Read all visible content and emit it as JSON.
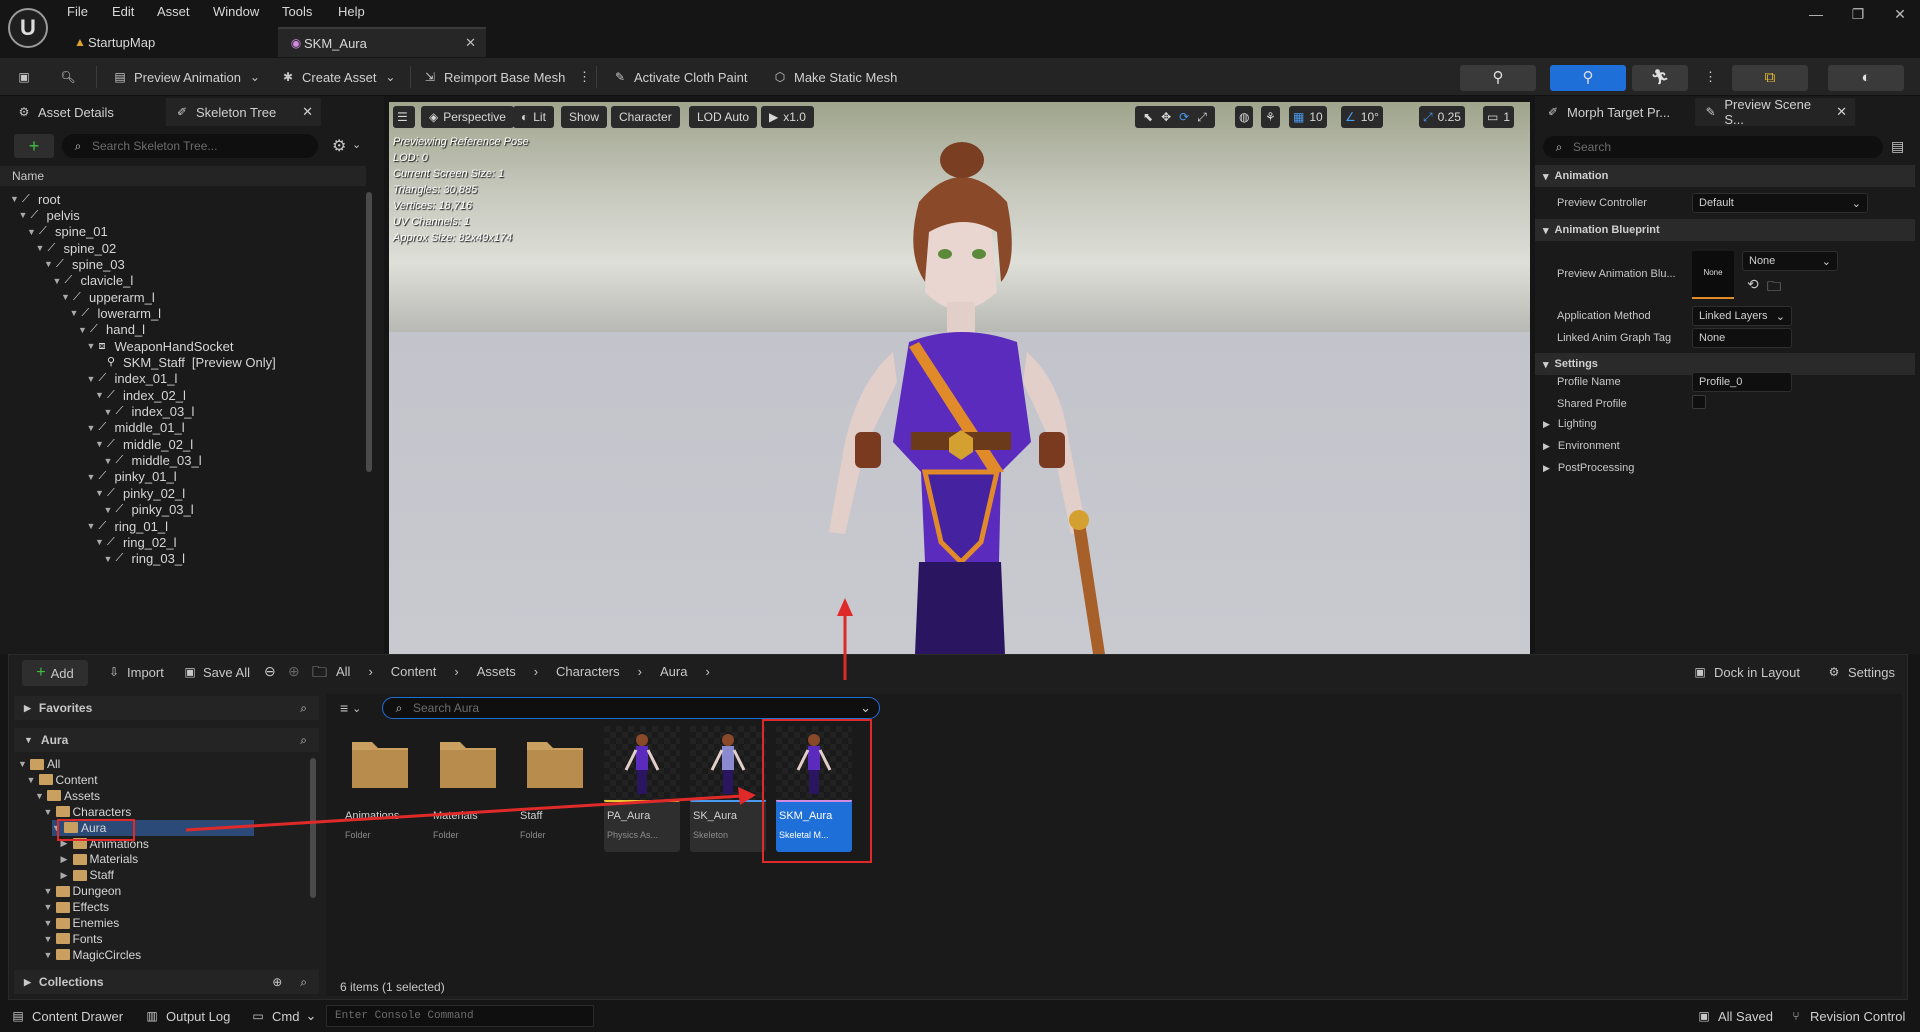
{
  "menu": [
    "File",
    "Edit",
    "Asset",
    "Window",
    "Tools",
    "Help"
  ],
  "tabs": [
    {
      "label": "StartupMap"
    },
    {
      "label": "SKM_Aura"
    }
  ],
  "toolbar": {
    "preview_animation": "Preview Animation",
    "create_asset": "Create Asset",
    "reimport": "Reimport Base Mesh",
    "cloth_paint": "Activate Cloth Paint",
    "make_static": "Make Static Mesh"
  },
  "left_tabs": {
    "asset_details": "Asset Details",
    "skeleton_tree": "Skeleton Tree"
  },
  "skeleton_search_placeholder": "Search Skeleton Tree...",
  "tree_header": "Name",
  "skeleton_tree": [
    {
      "label": "root",
      "depth": 0
    },
    {
      "label": "pelvis",
      "depth": 1
    },
    {
      "label": "spine_01",
      "depth": 2
    },
    {
      "label": "spine_02",
      "depth": 3
    },
    {
      "label": "spine_03",
      "depth": 4
    },
    {
      "label": "clavicle_l",
      "depth": 5
    },
    {
      "label": "upperarm_l",
      "depth": 6
    },
    {
      "label": "lowerarm_l",
      "depth": 7
    },
    {
      "label": "hand_l",
      "depth": 8
    },
    {
      "label": "WeaponHandSocket",
      "depth": 9
    },
    {
      "label": "SKM_Staff",
      "depth": 10,
      "suffix": "[Preview Only]"
    },
    {
      "label": "index_01_l",
      "depth": 9
    },
    {
      "label": "index_02_l",
      "depth": 10
    },
    {
      "label": "index_03_l",
      "depth": 11
    },
    {
      "label": "middle_01_l",
      "depth": 9
    },
    {
      "label": "middle_02_l",
      "depth": 10
    },
    {
      "label": "middle_03_l",
      "depth": 11
    },
    {
      "label": "pinky_01_l",
      "depth": 9
    },
    {
      "label": "pinky_02_l",
      "depth": 10
    },
    {
      "label": "pinky_03_l",
      "depth": 11
    },
    {
      "label": "ring_01_l",
      "depth": 9
    },
    {
      "label": "ring_02_l",
      "depth": 10
    },
    {
      "label": "ring_03_l",
      "depth": 11
    }
  ],
  "viewport": {
    "perspective": "Perspective",
    "lit": "Lit",
    "show": "Show",
    "character": "Character",
    "lod": "LOD Auto",
    "play": "x1.0",
    "grid": "10",
    "angle": "10°",
    "scale": "0.25",
    "camera": "1",
    "info": [
      "Previewing Reference Pose",
      "LOD: 0",
      "Current Screen Size: 1",
      "Triangles: 30,885",
      "Vertices: 18,716",
      "UV Channels: 1",
      "Approx Size: 82x49x174"
    ]
  },
  "right_tabs": {
    "morph": "Morph Target Pr...",
    "preview_scene": "Preview Scene S..."
  },
  "right_search_placeholder": "Search",
  "details": {
    "animation": "Animation",
    "preview_controller_label": "Preview Controller",
    "preview_controller_value": "Default",
    "anim_bp": "Animation Blueprint",
    "preview_anim_label": "Preview Animation Blu...",
    "preview_anim_thumb": "None",
    "preview_anim_value": "None",
    "app_method_label": "Application Method",
    "app_method_value": "Linked Layers",
    "linked_tag_label": "Linked Anim Graph Tag",
    "linked_tag_value": "None",
    "settings": "Settings",
    "profile_label": "Profile Name",
    "profile_value": "Profile_0",
    "shared_label": "Shared Profile",
    "lighting": "Lighting",
    "environment": "Environment",
    "postprocessing": "PostProcessing"
  },
  "content": {
    "add": "Add",
    "import": "Import",
    "save_all": "Save All",
    "crumbs": [
      "All",
      "Content",
      "Assets",
      "Characters",
      "Aura"
    ],
    "dock": "Dock in Layout",
    "settings": "Settings",
    "favorites": "Favorites",
    "aura_header": "Aura",
    "search_placeholder": "Search Aura",
    "collections": "Collections",
    "item_count": "6 items (1 selected)"
  },
  "folder_tree": [
    {
      "label": "All",
      "depth": 0
    },
    {
      "label": "Content",
      "depth": 1
    },
    {
      "label": "Assets",
      "depth": 2
    },
    {
      "label": "Characters",
      "depth": 3
    },
    {
      "label": "Aura",
      "depth": 4,
      "selected": true
    },
    {
      "label": "Animations",
      "depth": 5
    },
    {
      "label": "Materials",
      "depth": 5
    },
    {
      "label": "Staff",
      "depth": 5
    },
    {
      "label": "Dungeon",
      "depth": 3
    },
    {
      "label": "Effects",
      "depth": 3
    },
    {
      "label": "Enemies",
      "depth": 3
    },
    {
      "label": "Fonts",
      "depth": 3
    },
    {
      "label": "MagicCircles",
      "depth": 3
    }
  ],
  "assets": [
    {
      "name": "Animations",
      "type": "Folder",
      "kind": "folder"
    },
    {
      "name": "Materials",
      "type": "Folder",
      "kind": "folder"
    },
    {
      "name": "Staff",
      "type": "Folder",
      "kind": "folder"
    },
    {
      "name": "PA_Aura",
      "type": "Physics As...",
      "kind": "asset"
    },
    {
      "name": "SK_Aura",
      "type": "Skeleton",
      "kind": "asset"
    },
    {
      "name": "SKM_Aura",
      "type": "Skeletal M...",
      "kind": "asset",
      "selected": true
    }
  ],
  "status": {
    "content_drawer": "Content Drawer",
    "output_log": "Output Log",
    "cmd": "Cmd",
    "console_placeholder": "Enter Console Command",
    "all_saved": "All Saved",
    "revision": "Revision Control"
  },
  "colors": {
    "accent": "#1f6fd8",
    "annotation": "#e02a2a",
    "folder": "#c9a060"
  }
}
